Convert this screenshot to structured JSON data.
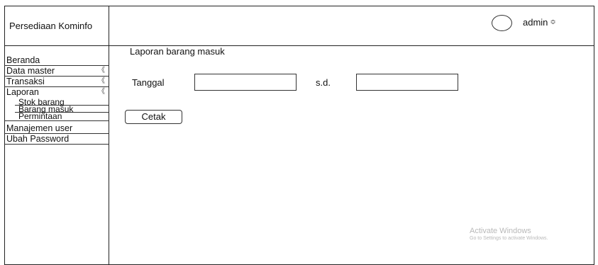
{
  "brand": {
    "title": "Persediaan Kominfo"
  },
  "topbar": {
    "username": "admin",
    "chevron": "≎",
    "avatar_icon": "user-avatar-icon"
  },
  "sidebar": {
    "items": [
      {
        "label": "Beranda",
        "arrow": ""
      },
      {
        "label": "Data master",
        "arrow": "《"
      },
      {
        "label": "Transaksi",
        "arrow": "《"
      },
      {
        "label": "Laporan",
        "arrow": "《"
      }
    ],
    "sub_items": [
      {
        "label": "Stok barang"
      },
      {
        "label": "Barang masuk"
      },
      {
        "label": "Permintaan"
      }
    ],
    "bottom_items": [
      {
        "label": "Manajemen user"
      },
      {
        "label": "Ubah Password"
      }
    ]
  },
  "main": {
    "title": "Laporan barang masuk",
    "date_label": "Tanggal",
    "date_from_value": "",
    "until_label": "s.d.",
    "date_to_value": "",
    "print_button": "Cetak"
  },
  "watermark": {
    "line1": "Activate Windows",
    "line2": "Go to Settings to activate Windows."
  }
}
